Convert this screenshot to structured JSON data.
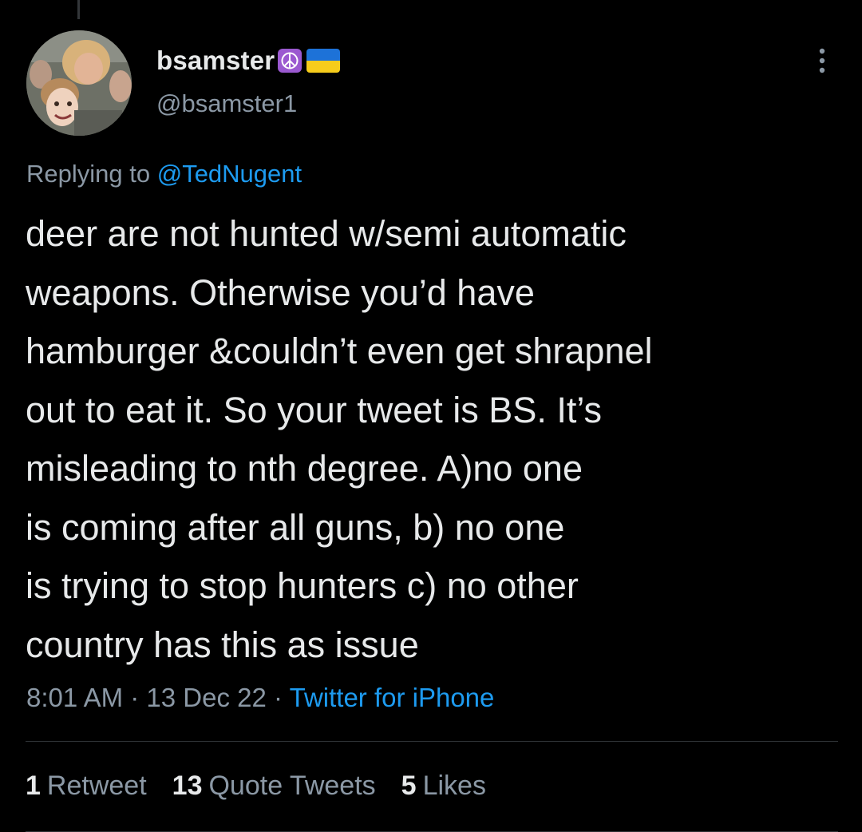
{
  "tweet": {
    "display_name": "bsamster",
    "badges": [
      "peace-symbol-icon",
      "ukraine-flag-icon"
    ],
    "handle": "@bsamster1",
    "replying_to_prefix": "Replying to",
    "replying_to_mention": "@TedNugent",
    "text_lines": [
      "deer are not hunted w/semi automatic",
      "weapons. Otherwise you’d have",
      "hamburger &couldn’t even get shrapnel",
      "out to eat it. So your tweet is BS. It’s",
      "misleading to nth degree. A)no one",
      "is coming after all guns, b) no one",
      "is trying to stop hunters c) no other",
      "country has this as issue"
    ],
    "time": "8:01 AM",
    "separator": "·",
    "date": "13 Dec 22",
    "source": "Twitter for iPhone"
  },
  "stats": {
    "retweets_count": "1",
    "retweets_label": "Retweet",
    "quotes_count": "13",
    "quotes_label": "Quote Tweets",
    "likes_count": "5",
    "likes_label": "Likes"
  },
  "colors": {
    "background": "#000000",
    "text": "#e7e9ea",
    "secondary": "#8b98a5",
    "accent": "#1d9bf0",
    "divider": "#2f3336"
  }
}
